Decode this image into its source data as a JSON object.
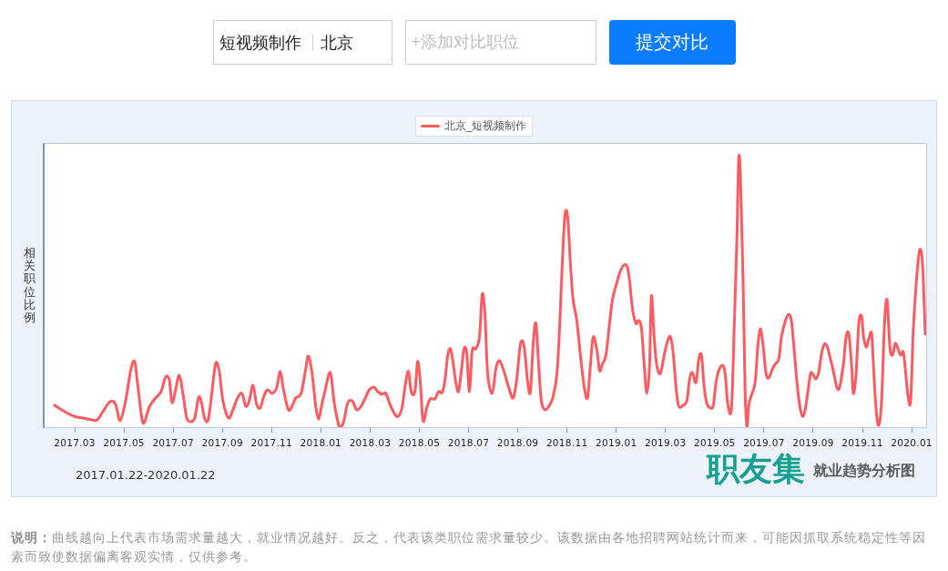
{
  "search": {
    "job": "短视频制作",
    "city": "北京",
    "compare_placeholder": "+添加对比职位",
    "submit_label": "提交对比"
  },
  "chart": {
    "legend": "北京_短视频制作",
    "ylabel": "相关职位比例",
    "xtick_labels": [
      "2017.03",
      "2017.05",
      "2017.07",
      "2017.09",
      "2017.11",
      "2018.01",
      "2018.03",
      "2018.05",
      "2018.07",
      "2018.09",
      "2018.11",
      "2019.01",
      "2019.03",
      "2019.05",
      "2019.07",
      "2019.09",
      "2019.11",
      "2020.01"
    ],
    "date_range": "2017.01.22-2020.01.22",
    "logo": "职友集",
    "logo_caption": "就业趋势分析图"
  },
  "note": "**说明：**曲线越向上代表市场需求量越大，就业情况越好。反之，代表该类职位需求量较少。该数据由各地招聘网站统计而来，可能因抓取系统稳定性等因素而致使数据偏离客观实情，仅供参考。"
}
